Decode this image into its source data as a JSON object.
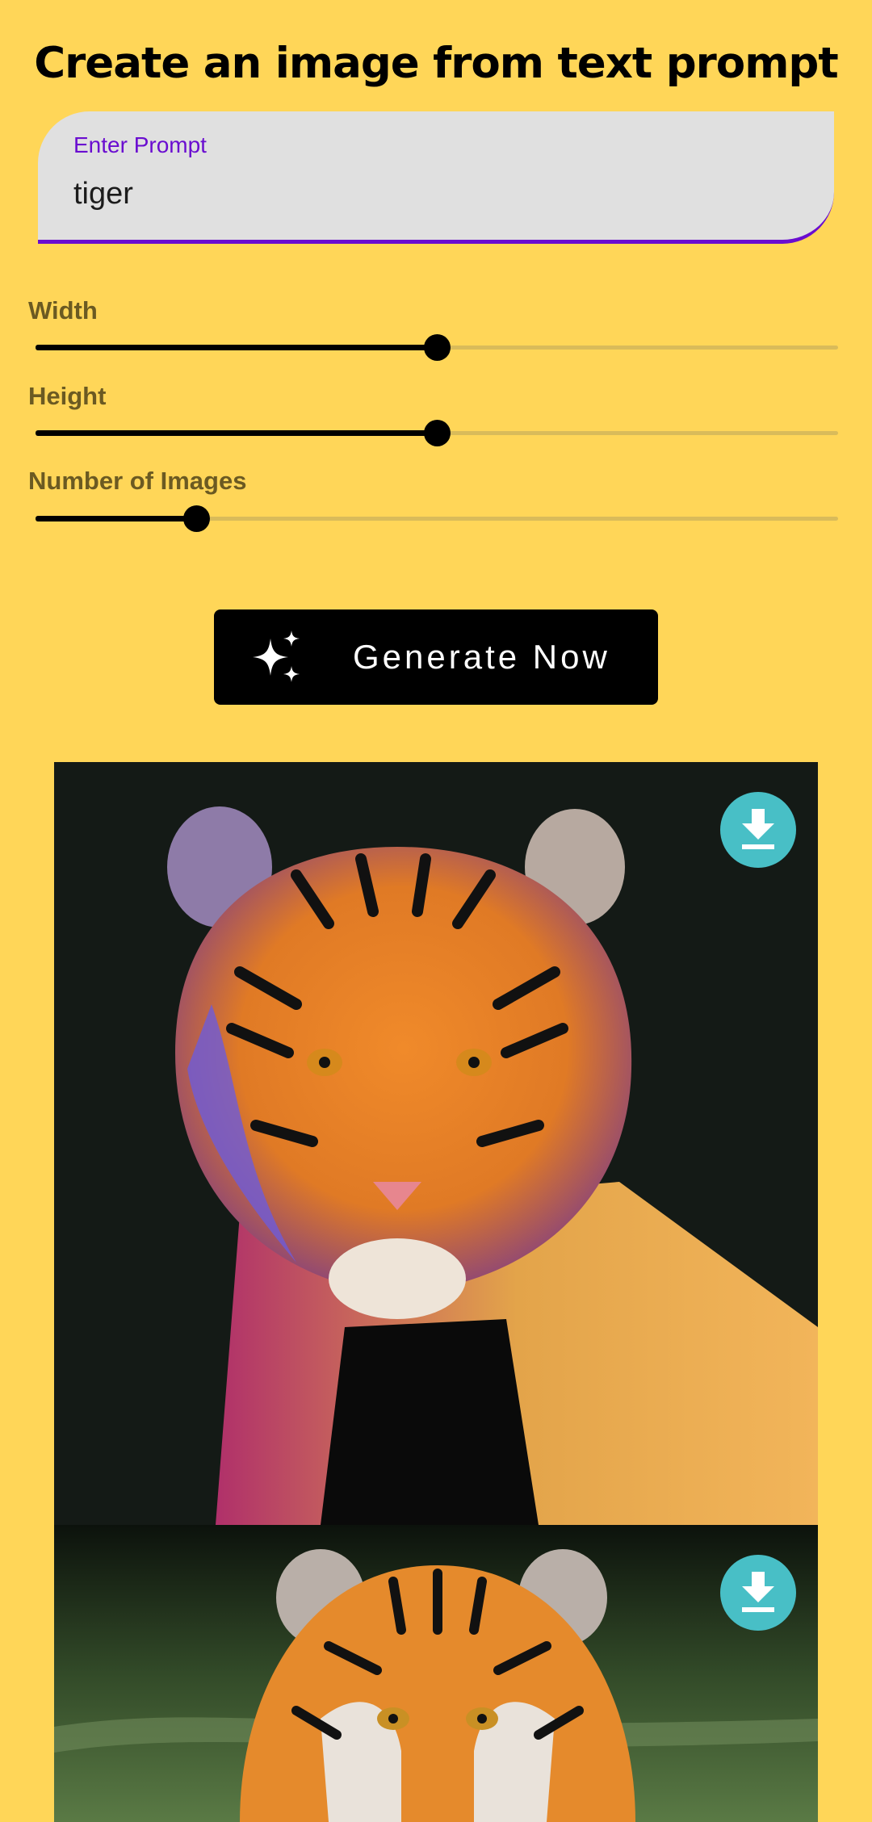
{
  "header": {
    "title": "Create an image from text prompt"
  },
  "prompt": {
    "label": "Enter Prompt",
    "value": "tiger"
  },
  "sliders": [
    {
      "label": "Width",
      "fraction": 0.5
    },
    {
      "label": "Height",
      "fraction": 0.5
    },
    {
      "label": "Number of Images",
      "fraction": 0.2
    }
  ],
  "generate_button": {
    "label": "Generate Now",
    "icon": "sparkle-icon"
  },
  "results": [
    {
      "icon": "download-icon"
    },
    {
      "icon": "download-icon"
    }
  ],
  "colors": {
    "background": "#FFD658",
    "accent": "#6A0DD0",
    "button": "#000000",
    "download": "#48BFC6"
  }
}
